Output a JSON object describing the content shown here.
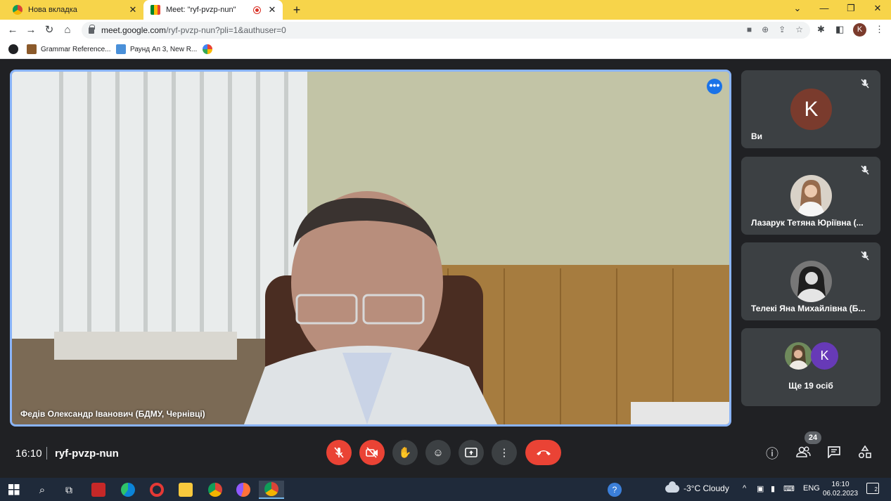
{
  "browser": {
    "tabs": [
      {
        "title": "Нова вкладка",
        "active": false
      },
      {
        "title": "Meet: \"ryf-pvzp-nun\"",
        "active": true,
        "recording": true
      }
    ],
    "url_host": "meet.google.com",
    "url_path": "/ryf-pvzp-nun?pli=1&authuser=0",
    "profile_initial": "K",
    "bookmarks": [
      "Grammar Reference...",
      "Раунд Ап 3, New R..."
    ]
  },
  "meet": {
    "main_speaker": "Федів Олександр Іванович (БДМУ, Чернівці)",
    "participants": [
      {
        "name": "Ви",
        "initial": "K",
        "avatar_color": "#7a3b2d",
        "muted": true
      },
      {
        "name": "Лазарук Тетяна Юріївна (...",
        "muted": true
      },
      {
        "name": "Телекі Яна Михайлівна (Б...",
        "muted": true
      }
    ],
    "others": {
      "label": "Ще 19 осіб",
      "initial": "K",
      "color": "#673ab7"
    },
    "time": "16:10",
    "meeting_code": "ryf-pvzp-nun",
    "people_count": "24"
  },
  "taskbar": {
    "weather": "-3°C  Cloudy",
    "lang": "ENG",
    "time": "16:10",
    "date": "06.02.2023",
    "notifications": "2"
  }
}
